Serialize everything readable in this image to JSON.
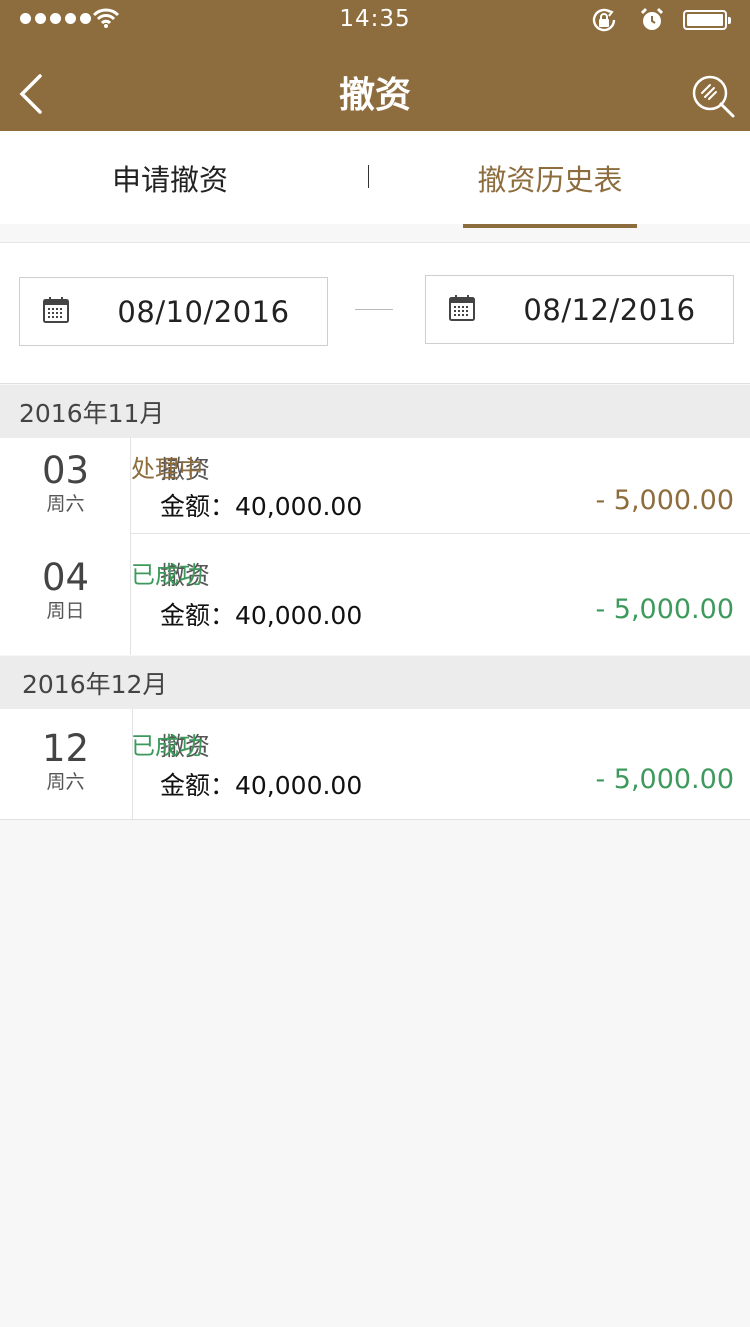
{
  "status_bar": {
    "time": "14:35",
    "signal_icon": "signal-dots-icon",
    "wifi_icon": "wifi-icon",
    "rotation_lock_icon": "rotation-lock-icon",
    "alarm_icon": "alarm-clock-icon",
    "battery_icon": "battery-icon"
  },
  "header": {
    "title": "撤资",
    "back_icon": "chevron-left-icon",
    "search_icon": "search-icon"
  },
  "tabs": [
    {
      "label": "申请撤资",
      "active": false
    },
    {
      "label": "撤资历史表",
      "active": true
    }
  ],
  "filter": {
    "start_date": "08/10/2016",
    "end_date": "08/12/2016",
    "calendar_icon": "calendar-icon"
  },
  "groups": [
    {
      "month": "2016年11月",
      "records": [
        {
          "day": "03",
          "weekday": "周六",
          "type": "撤资",
          "amount": "金额：40,000.00",
          "status": "处理中",
          "delta": "- 5,000.00"
        },
        {
          "day": "04",
          "weekday": "周日",
          "type": "撤资",
          "amount": "金额：40,000.00",
          "status": "已成功",
          "delta": "- 5,000.00"
        }
      ]
    },
    {
      "month": "2016年12月",
      "records": [
        {
          "day": "12",
          "weekday": "周六",
          "type": "撤资",
          "amount": "金额：40,000.00",
          "status": "已成功",
          "delta": "- 5,000.00"
        }
      ]
    }
  ],
  "colors": {
    "brand": "#8d6d3e",
    "processing": "#8d6d3e",
    "success": "#3e9a5c"
  }
}
